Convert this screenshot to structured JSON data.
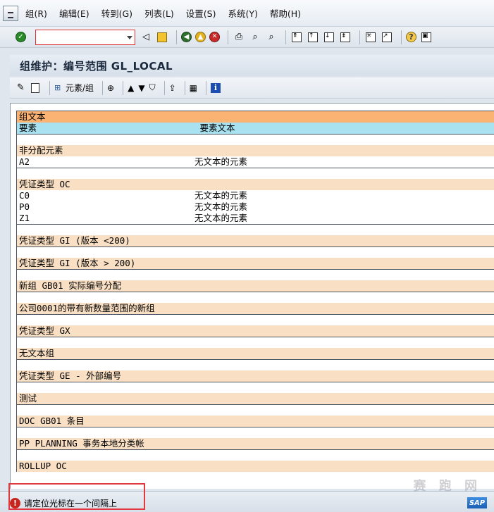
{
  "menu": {
    "items": [
      "组(R)",
      "编辑(E)",
      "转到(G)",
      "列表(L)",
      "设置(S)",
      "系统(Y)",
      "帮助(H)"
    ]
  },
  "toolbar": {
    "command_value": ""
  },
  "title": "组维护：编号范围 GL_LOCAL",
  "app_toolbar": {
    "elements_group_label": "元素/组"
  },
  "list": {
    "group_text_header": "组文本",
    "col_element": "要素",
    "col_element_text": "要素文本",
    "groups": [
      {
        "name": "非分配元素",
        "rows": [
          {
            "element": "A2",
            "text": "无文本的元素"
          }
        ]
      },
      {
        "name": "凭证类型 OC",
        "rows": [
          {
            "element": "C0",
            "text": "无文本的元素"
          },
          {
            "element": "P0",
            "text": "无文本的元素"
          },
          {
            "element": "Z1",
            "text": "无文本的元素"
          }
        ]
      },
      {
        "name": "凭证类型 GI (版本 <200)",
        "rows": []
      },
      {
        "name": "凭证类型 GI (版本 > 200)",
        "rows": []
      },
      {
        "name": "新组 GB01 实际编号分配",
        "rows": []
      },
      {
        "name": "公司0001的带有新数量范围的新组",
        "rows": []
      },
      {
        "name": "凭证类型 GX",
        "rows": []
      },
      {
        "name": "无文本组",
        "rows": []
      },
      {
        "name": "凭证类型 GE - 外部编号",
        "rows": []
      },
      {
        "name": "测试",
        "rows": []
      },
      {
        "name": "DOC GB01 条目",
        "rows": []
      },
      {
        "name": "PP PLANNING 事务本地分类帐",
        "rows": []
      },
      {
        "name": "ROLLUP OC",
        "rows": []
      }
    ]
  },
  "status": {
    "message": "请定位光标在一个间隔上",
    "logo": "SAP",
    "watermark": "赛 跑 网"
  }
}
